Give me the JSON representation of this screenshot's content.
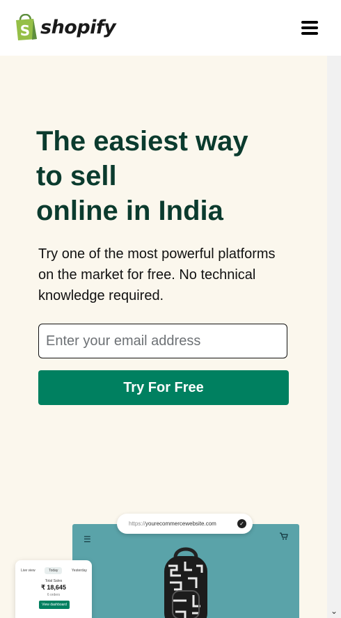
{
  "header": {
    "logo_text": "shopify",
    "menu_icon": "hamburger-menu-icon"
  },
  "hero": {
    "title_lines": [
      "The easiest way",
      "to sell",
      "online in India"
    ],
    "subtitle": "Try one of the most powerful platforms on the market for free. No technical knowledge required.",
    "email_placeholder": "Enter your email address",
    "email_value": "",
    "cta_label": "Try For Free"
  },
  "preview": {
    "url_prefix": "https://",
    "url_domain": "yourecommercewebsite.com",
    "dashboard": {
      "tabs": [
        "Live view",
        "Today",
        "Yesterday"
      ],
      "active_tab": "Today",
      "label": "Total Sales",
      "value": "₹ 18,645",
      "orders": "6 orders",
      "button": "View dashboard"
    }
  },
  "colors": {
    "brand_green": "#008060",
    "headline": "#0b3b2e",
    "background": "#fbf7ed",
    "logo_green": "#95bf47",
    "store_teal": "#5aa3a9"
  }
}
